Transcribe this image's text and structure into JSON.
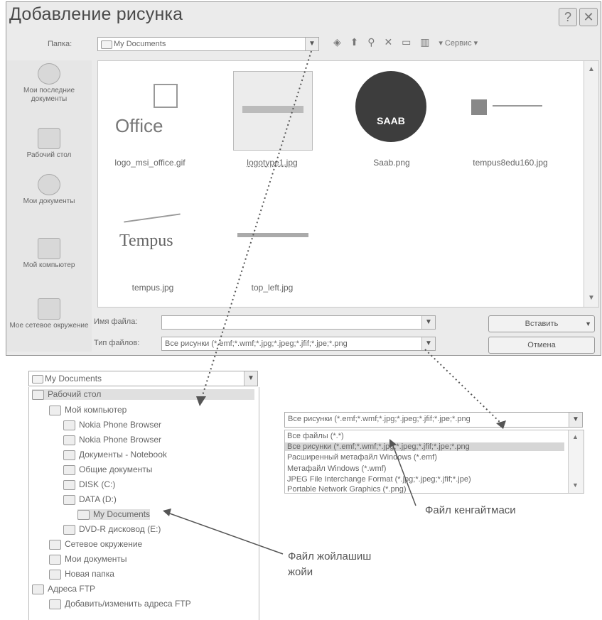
{
  "dialog": {
    "title": "Добавление рисунка",
    "help_label": "?",
    "close_label": "✕",
    "folder_label": "Папка:",
    "folder_value": "My Documents",
    "toolbar_service": "▾ Сервис ▾",
    "places": [
      "Мои последние документы",
      "Рабочий стол",
      "Мои документы",
      "Мой компьютер",
      "Мое сетевое окружение"
    ],
    "files": [
      {
        "name": "logo_msi_office.gif",
        "art": "Office"
      },
      {
        "name": "logotype1.jpg",
        "art": ""
      },
      {
        "name": "Saab.png",
        "art": "SAAB"
      },
      {
        "name": "tempus8edu160.jpg",
        "art": ""
      },
      {
        "name": "tempus.jpg",
        "art": "Tempus"
      },
      {
        "name": "top_left.jpg",
        "art": ""
      }
    ],
    "filename_label": "Имя файла:",
    "filename_value": "",
    "filetype_label": "Тип файлов:",
    "filetype_value": "Все рисунки (*.emf;*.wmf;*.jpg;*.jpeg;*.jfif;*.jpe;*.png",
    "insert_label": "Вставить",
    "cancel_label": "Отмена"
  },
  "folder_tree": {
    "header": "My Documents",
    "items": [
      "Рабочий стол",
      "Мой компьютер",
      "Nokia Phone Browser",
      "Nokia Phone Browser",
      "Документы - Notebook",
      "Общие документы",
      "DISK (C:)",
      "DATA (D:)",
      "My Documents",
      "DVD-R дисковод (E:)",
      "Сетевое окружение",
      "Мои документы",
      "Новая папка",
      "Адреса FTP",
      "Добавить/изменить адреса FTP"
    ]
  },
  "type_list": {
    "header": "Все рисунки (*.emf;*.wmf;*.jpg;*.jpeg;*.jfif;*.jpe;*.png",
    "items": [
      "Все файлы (*.*)",
      "Все рисунки (*.emf;*.wmf;*.jpg;*.jpeg;*.jfif;*.jpe;*.png",
      "Расширенный метафайл Windows (*.emf)",
      "Метафайл Windows (*.wmf)",
      "JPEG File Interchange Format (*.jpg;*.jpeg;*.jfif;*.jpe)",
      "Portable Network Graphics (*.png)"
    ]
  },
  "captions": {
    "file_type": "Файл кенгайтмаси",
    "location_line1": "Файл жойлашиш",
    "location_line2": "жойи"
  }
}
